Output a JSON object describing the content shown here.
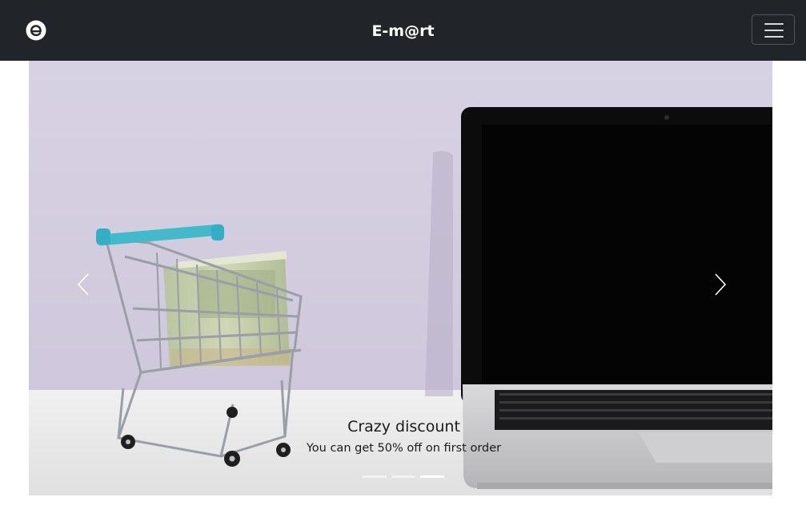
{
  "navbar": {
    "brand": "E-m@rt",
    "logo_icon": "e-logo-icon",
    "menu_icon": "hamburger-menu-icon",
    "background": "#212529"
  },
  "carousel": {
    "slides_total": 3,
    "active_slide": 3,
    "caption": {
      "title": "Crazy discount",
      "text": "You can get 50% off on first order"
    },
    "prev_icon": "chevron-left-icon",
    "next_icon": "chevron-right-icon"
  }
}
